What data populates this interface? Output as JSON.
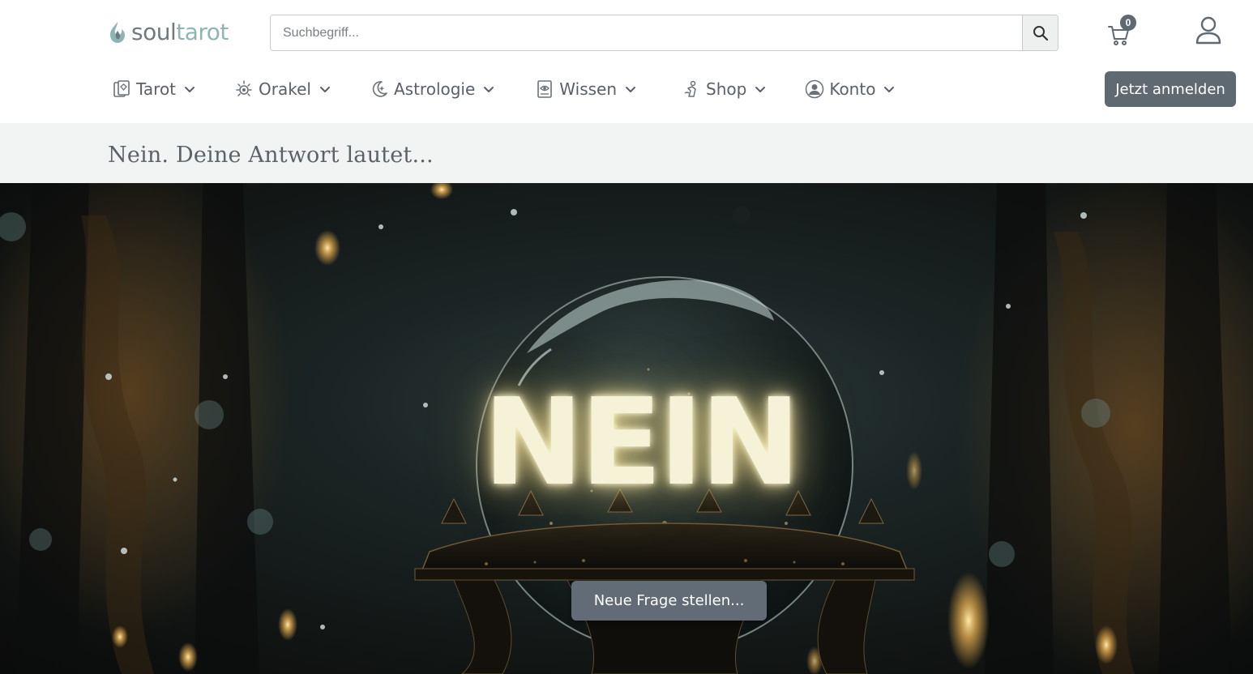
{
  "brand": {
    "name_part1": "soul",
    "name_part2": "tarot"
  },
  "search": {
    "placeholder": "Suchbegriff...",
    "button_icon": "search-icon"
  },
  "cart": {
    "count": "0",
    "icon": "cart-icon"
  },
  "account_icon": "user-icon",
  "nav": {
    "items": [
      {
        "label": "Tarot",
        "icon": "tarot-card-icon"
      },
      {
        "label": "Orakel",
        "icon": "sun-oracle-icon"
      },
      {
        "label": "Astrologie",
        "icon": "moon-star-icon"
      },
      {
        "label": "Wissen",
        "icon": "book-eye-icon"
      },
      {
        "label": "Shop",
        "icon": "shop-figure-icon"
      },
      {
        "label": "Konto",
        "icon": "account-circle-icon"
      }
    ],
    "login_label": "Jetzt anmelden"
  },
  "page": {
    "title": "Nein. Deine Antwort lautet..."
  },
  "hero": {
    "answer": "NEIN",
    "button_label": "Neue Frage stellen..."
  },
  "colors": {
    "accent_button": "#5f6972",
    "title_strip_bg": "#f1f4f3",
    "logo_soul": "#6f7a80",
    "logo_tarot": "#8fb5b3",
    "answer_glow": "#f6f2d8"
  }
}
